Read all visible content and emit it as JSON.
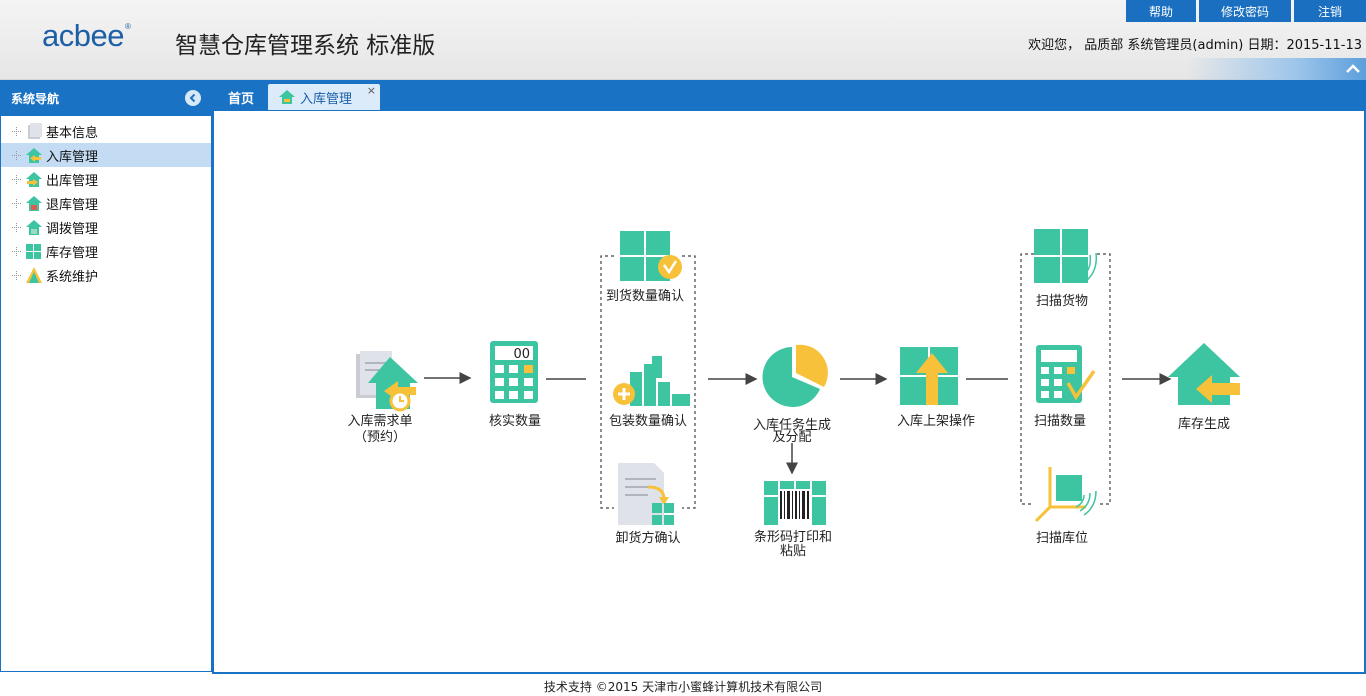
{
  "header": {
    "logo": "acbee",
    "logo_mark": "®",
    "title": "智慧仓库管理系统 标准版",
    "buttons": [
      "帮助",
      "修改密码",
      "注销"
    ],
    "welcome": "欢迎您， 品质部 系统管理员(admin) 日期：2015-11-13"
  },
  "sidebar": {
    "title": "系统导航",
    "items": [
      {
        "label": "基本信息",
        "icon": "info-icon"
      },
      {
        "label": "入库管理",
        "icon": "inbound-icon",
        "active": true
      },
      {
        "label": "出库管理",
        "icon": "outbound-icon"
      },
      {
        "label": "退库管理",
        "icon": "return-icon"
      },
      {
        "label": "调拨管理",
        "icon": "transfer-icon"
      },
      {
        "label": "库存管理",
        "icon": "inventory-icon"
      },
      {
        "label": "系统维护",
        "icon": "maintenance-icon"
      }
    ]
  },
  "tabs": [
    {
      "label": "首页",
      "active": false
    },
    {
      "label": "入库管理",
      "active": true,
      "close": "×"
    }
  ],
  "flow": {
    "request": [
      "入库需求单",
      "（预约）"
    ],
    "verify": "核实数量",
    "arrival": "到货数量确认",
    "package": "包装数量确认",
    "unload": "卸货方确认",
    "task": [
      "入库任务生成",
      "及分配"
    ],
    "barcode": [
      "条形码打印和",
      "粘贴"
    ],
    "shelf": "入库上架操作",
    "scan_goods": "扫描货物",
    "scan_qty": "扫描数量",
    "scan_loc": "扫描库位",
    "stock": "库存生成",
    "calc_display": "00"
  },
  "colors": {
    "brand": "#1a72c4",
    "accent_green": "#3dc4a0",
    "accent_yellow": "#f7c13a"
  },
  "footer": "技术支持 ©2015 天津市小蜜蜂计算机技术有限公司"
}
